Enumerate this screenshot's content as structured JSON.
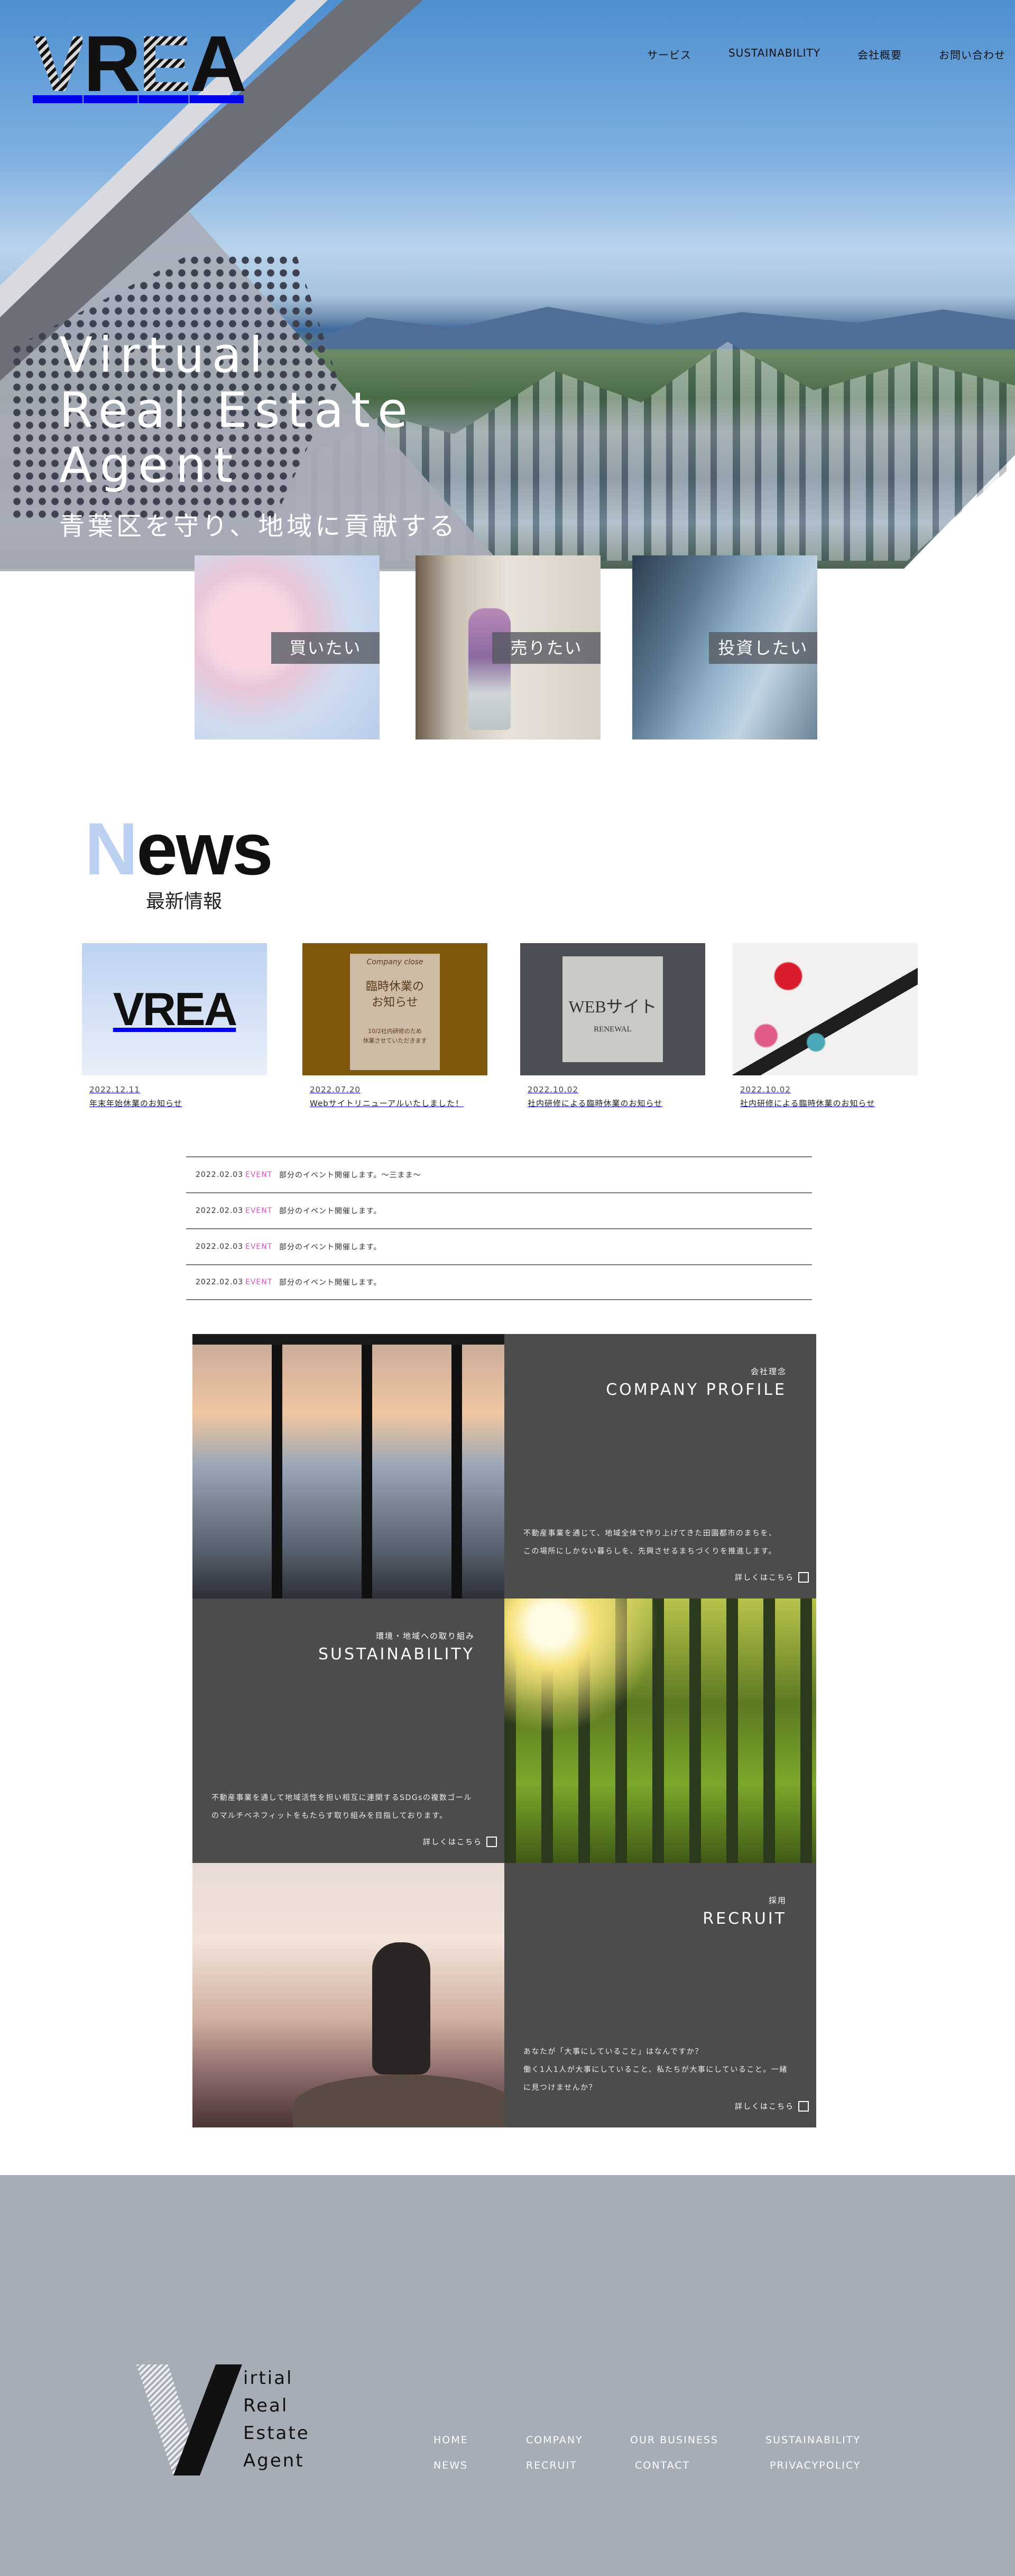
{
  "brand": {
    "logo": [
      "V",
      "R",
      "E",
      "A"
    ]
  },
  "nav": [
    "サービス",
    "SUSTAINABILITY",
    "会社概要",
    "お問い合わせ"
  ],
  "hero": {
    "title_lines": [
      "Virtual",
      "Real Estate",
      "Agent"
    ],
    "subtitle": "青葉区を守り、地域に貢献する"
  },
  "services": [
    {
      "label": "買いたい"
    },
    {
      "label": "売りたい"
    },
    {
      "label": "投資したい"
    }
  ],
  "news": {
    "heading_first": "N",
    "heading_rest": "ews",
    "subheading": "最新情報",
    "items": [
      {
        "date": "2022.12.11",
        "title": "年末年始休業のお知らせ",
        "thumb": "VREA"
      },
      {
        "date": "2022.07.20",
        "title": "Webサイトリニューアルいたしました！",
        "thumb_script": "Company close",
        "thumb_title": "臨時休業の\nお知らせ",
        "thumb_note": "10/2社内研修のため\n休業させていただきます"
      },
      {
        "date": "2022.10.02",
        "title": "社内研修による臨時休業のお知らせ",
        "thumb_title": "WEBサイト",
        "thumb_note": "RENEWAL"
      },
      {
        "date": "2022.10.02",
        "title": "社内研修による臨時休業のお知らせ"
      }
    ]
  },
  "events": [
    {
      "date": "2022.02.03",
      "tag": "EVENT",
      "text": "部分のイベント開催します。〜三まま〜"
    },
    {
      "date": "2022.02.03",
      "tag": "EVENT",
      "text": "部分のイベント開催します。"
    },
    {
      "date": "2022.02.03",
      "tag": "EVENT",
      "text": "部分のイベント開催します。"
    },
    {
      "date": "2022.02.03",
      "tag": "EVENT",
      "text": "部分のイベント開催します。"
    }
  ],
  "sections": {
    "company": {
      "small": "会社理念",
      "big": "COMPANY PROFILE",
      "body": [
        "不動産事業を通じて、地域全体で作り上げてきた田園都市のまちを、",
        "この場所にしかない暮らしを、先興させるまちづくりを推進します。"
      ],
      "more": "詳しくはこちら"
    },
    "sustainability": {
      "small": "環境・地域への取り組み",
      "big": "SUSTAINABILITY",
      "body": [
        "不動産事業を通して地域活性を担い相互に連関するSDGsの複数ゴール",
        "のマルチベネフィットをもたらす取り組みを目指しております。"
      ],
      "more": "詳しくはこちら"
    },
    "recruit": {
      "small": "採用",
      "big": "RECRUIT",
      "body": [
        "あなたが「大事にしていること」はなんですか？",
        "働く1人1人が大事にしていること、私たちが大事にしていること。一緒",
        "に見つけませんか？"
      ],
      "more": "詳しくはこちら"
    }
  },
  "footer": {
    "logo_letters": [
      "irtial",
      "Real",
      "Estate",
      "Agent"
    ],
    "links_row1": [
      "HOME",
      "COMPANY",
      "OUR BUSINESS",
      "SUSTAINABILITY"
    ],
    "links_row2": [
      "NEWS",
      "RECRUIT",
      "CONTACT",
      "PRIVACYPOLICY"
    ]
  },
  "colors": {
    "accent": "#bcd0f2",
    "event_tag": "#e055c4",
    "panel": "#4c4c4c",
    "footer": "#a6adb6"
  }
}
